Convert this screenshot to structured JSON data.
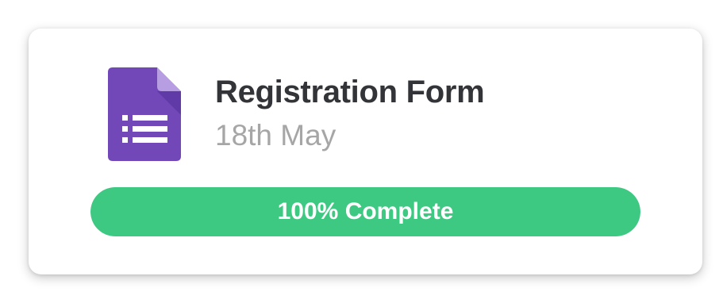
{
  "form": {
    "title": "Registration Form",
    "date": "18th May",
    "icon": "google-forms-icon"
  },
  "progress": {
    "value": 1.0,
    "label": "100% Complete"
  },
  "colors": {
    "progress_fill": "#3ec983",
    "icon_primary": "#7248b9",
    "icon_fold": "#b79ee3",
    "icon_shade": "#5e3aa5",
    "title": "#333438",
    "date": "#a6a6a6"
  }
}
